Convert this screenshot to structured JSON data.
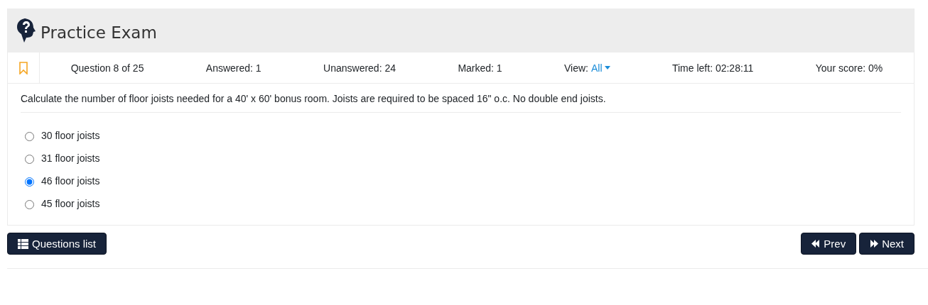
{
  "header": {
    "title": "Practice Exam"
  },
  "bookmark": {
    "marked": false
  },
  "stats": [
    {
      "kind": "text",
      "text": "Question 8 of 25"
    },
    {
      "kind": "text",
      "text": "Answered: 1"
    },
    {
      "kind": "text",
      "text": "Unanswered: 24"
    },
    {
      "kind": "text",
      "text": "Marked: 1"
    },
    {
      "kind": "view",
      "label": "View:",
      "value": "All"
    },
    {
      "kind": "text",
      "text": "Time left: 02:28:11"
    },
    {
      "kind": "text",
      "text": "Your score: 0%"
    }
  ],
  "question": {
    "text": "Calculate the number of floor joists needed for a 40' x 60' bonus room. Joists are required to be spaced 16\" o.c. No double end joists.",
    "options": [
      {
        "label": "30 floor joists",
        "selected": false
      },
      {
        "label": "31 floor joists",
        "selected": false
      },
      {
        "label": "46 floor joists",
        "selected": true
      },
      {
        "label": "45 floor joists",
        "selected": false
      }
    ]
  },
  "buttons": {
    "list": "Questions list",
    "prev": "Prev",
    "next": "Next"
  }
}
